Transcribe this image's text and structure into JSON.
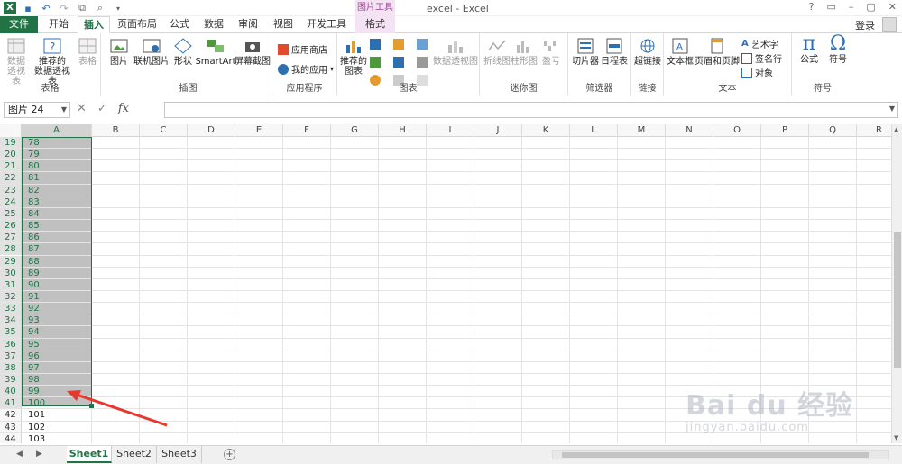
{
  "window": {
    "title": "excel - Excel",
    "context_group": "图片工具",
    "controls": [
      "?",
      "▭",
      "–",
      "▢",
      "✕"
    ]
  },
  "tabs": [
    "文件",
    "开始",
    "插入",
    "页面布局",
    "公式",
    "数据",
    "审阅",
    "视图",
    "开发工具",
    "格式"
  ],
  "account": {
    "login": "登录"
  },
  "ribbon": {
    "groups": {
      "tables": "表格",
      "illustrations": "插图",
      "apps": "应用程序",
      "charts": "图表",
      "sparklines": "迷你图",
      "filters": "筛选器",
      "links": "链接",
      "text": "文本",
      "symbols": "符号"
    },
    "buttons": {
      "pivot_l1": "数据",
      "pivot_l2": "透视表",
      "rec_pivot_l1": "推荐的",
      "rec_pivot_l2": "数据透视表",
      "table": "表格",
      "picture": "图片",
      "online_picture": "联机图片",
      "shapes": "形状",
      "smartart": "SmartArt",
      "screenshot": "屏幕截图",
      "app_store": "应用商店",
      "my_apps": "我的应用",
      "rec_charts_l1": "推荐的",
      "rec_charts_l2": "图表",
      "pivot_chart": "数据透视图",
      "spark_line": "折线图",
      "spark_column": "柱形图",
      "spark_winloss": "盈亏",
      "slicer": "切片器",
      "timeline": "日程表",
      "hyperlink": "超链接",
      "textbox": "文本框",
      "header_footer": "页眉和页脚",
      "wordart": "艺术字",
      "signature": "签名行",
      "object": "对象",
      "equation": "公式",
      "symbol": "符号"
    }
  },
  "formula_bar": {
    "name_box": "图片 24",
    "cancel": "✕",
    "enter": "✓",
    "fx": "fx",
    "value": ""
  },
  "columns": [
    "A",
    "B",
    "C",
    "D",
    "E",
    "F",
    "G",
    "H",
    "I",
    "J",
    "K",
    "L",
    "M",
    "N",
    "O",
    "P",
    "Q",
    "R"
  ],
  "rows": [
    "19",
    "20",
    "21",
    "22",
    "23",
    "24",
    "25",
    "26",
    "27",
    "28",
    "29",
    "30",
    "31",
    "32",
    "33",
    "34",
    "35",
    "36",
    "37",
    "38",
    "39",
    "40",
    "41",
    "42",
    "43",
    "44"
  ],
  "cells_A": [
    "78",
    "79",
    "80",
    "81",
    "82",
    "83",
    "84",
    "85",
    "86",
    "87",
    "88",
    "89",
    "90",
    "91",
    "92",
    "93",
    "94",
    "95",
    "96",
    "97",
    "98",
    "99",
    "100",
    "101",
    "102",
    "103"
  ],
  "sheets": [
    "Sheet1",
    "Sheet2",
    "Sheet3"
  ],
  "sheet_nav": {
    "add": "+"
  },
  "watermark": {
    "brand": "Bai du 经验",
    "url": "jingyan.baidu.com"
  }
}
